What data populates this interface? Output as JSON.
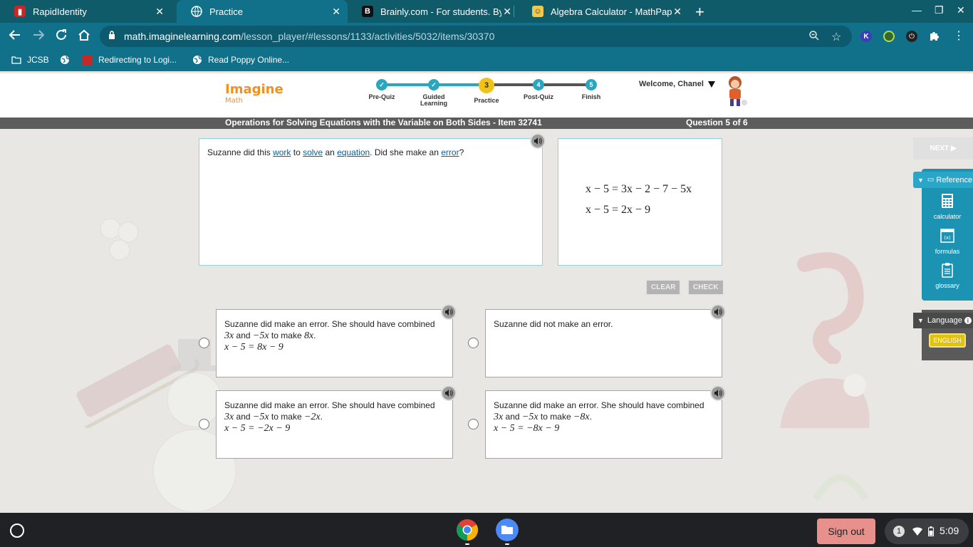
{
  "browser": {
    "tabs": [
      {
        "title": "RapidIdentity",
        "favicon": "rapididentity-icon",
        "active": false
      },
      {
        "title": "Practice",
        "favicon": "globe-icon",
        "active": true
      },
      {
        "title": "Brainly.com - For students. By st",
        "favicon": "brainly-icon",
        "active": false
      },
      {
        "title": "Algebra Calculator - MathPapa",
        "favicon": "mathpapa-icon",
        "active": false
      }
    ],
    "url_host": "math.imaginelearning.com",
    "url_path": "/lesson_player/#lessons/1133/activities/5032/items/30370",
    "bookmarks": [
      {
        "label": "JCSB",
        "icon": "folder-icon"
      },
      {
        "label": "",
        "icon": "globe-icon"
      },
      {
        "label": "Redirecting to Logi...",
        "icon": "rapididentity-icon"
      },
      {
        "label": "Read Poppy Online...",
        "icon": "globe-icon"
      }
    ]
  },
  "app": {
    "logo_main": "Imagine",
    "logo_sub": "Math",
    "steps": [
      {
        "mark": "✓",
        "label": "Pre-Quiz",
        "state": "done"
      },
      {
        "mark": "✓",
        "label": "Guided Learning",
        "state": "done"
      },
      {
        "mark": "3",
        "label": "Practice",
        "state": "current"
      },
      {
        "mark": "4",
        "label": "Post-Quiz",
        "state": "todo"
      },
      {
        "mark": "5",
        "label": "Finish",
        "state": "todo"
      }
    ],
    "welcome": "Welcome, Chanel",
    "lesson_title": "Operations for Solving Equations with the Variable on Both Sides - Item 32741",
    "question_counter": "Question 5 of 6"
  },
  "question": {
    "parts": [
      {
        "text": "Suzanne did this ",
        "link": false
      },
      {
        "text": "work",
        "link": true
      },
      {
        "text": " to ",
        "link": false
      },
      {
        "text": "solve",
        "link": true
      },
      {
        "text": " an ",
        "link": false
      },
      {
        "text": "equation",
        "link": true
      },
      {
        "text": ". Did she make an ",
        "link": false
      },
      {
        "text": "error",
        "link": true
      },
      {
        "text": "?",
        "link": false
      }
    ],
    "work_lines": [
      "x − 5 = 3x − 2 − 7 − 5x",
      "x − 5 = 2x − 9"
    ]
  },
  "buttons": {
    "clear": "CLEAR",
    "check": "CHECK",
    "next": "NEXT ▶"
  },
  "choices": [
    {
      "line1": "Suzanne did make an error. She should have combined",
      "line2_a": "3x",
      "line2_b": " and ",
      "line2_c": "−5x",
      "line2_d": " to make ",
      "line2_e": "8x",
      "line2_f": ".",
      "line3": "x − 5 = 8x − 9"
    },
    {
      "line1": "Suzanne did not make an error.",
      "line2_a": "",
      "line2_b": "",
      "line2_c": "",
      "line2_d": "",
      "line2_e": "",
      "line2_f": "",
      "line3": ""
    },
    {
      "line1": "Suzanne did make an error. She should have combined",
      "line2_a": "3x",
      "line2_b": " and ",
      "line2_c": "−5x",
      "line2_d": " to make ",
      "line2_e": "−2x",
      "line2_f": ".",
      "line3": "x − 5 = −2x − 9"
    },
    {
      "line1": "Suzanne did make an error. She should have combined",
      "line2_a": "3x",
      "line2_b": " and ",
      "line2_c": "−5x",
      "line2_d": " to make ",
      "line2_e": "−8x",
      "line2_f": ".",
      "line3": "x − 5 = −8x − 9"
    }
  ],
  "reference": {
    "header": "Reference",
    "items": [
      {
        "label": "calculator",
        "icon": "calculator-icon"
      },
      {
        "label": "formulas",
        "icon": "formulas-icon"
      },
      {
        "label": "glossary",
        "icon": "glossary-icon"
      }
    ]
  },
  "language": {
    "header": "Language",
    "selected": "ENGLISH"
  },
  "shelf": {
    "sign_out": "Sign out",
    "notifications": "1",
    "time": "5:09"
  },
  "colors": {
    "chrome": "#11708a",
    "accent": "#2aa7bf",
    "current_step": "#f2c314",
    "logo": "#f4901e",
    "link": "#0a5f99"
  }
}
